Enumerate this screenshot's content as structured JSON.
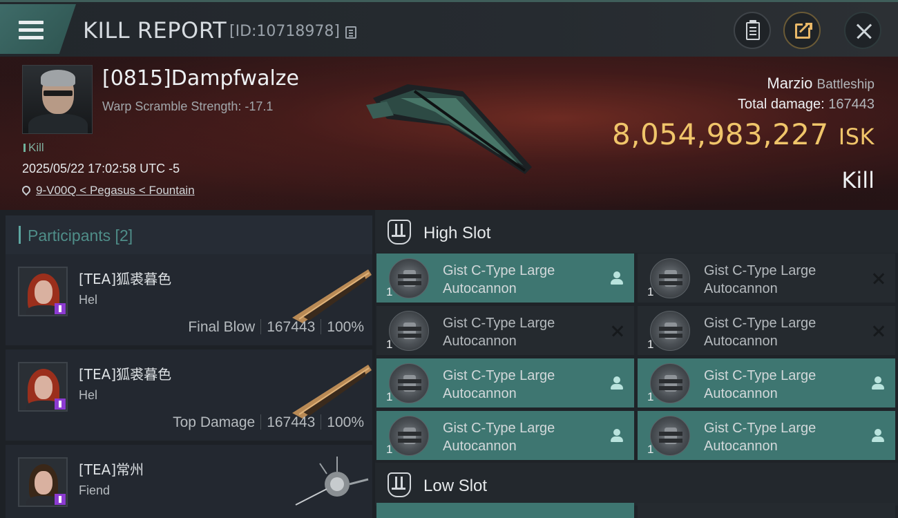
{
  "header": {
    "title": "KILL REPORT",
    "id_label": "[ID:10718978]"
  },
  "victim": {
    "name": "[0815]Dampfwalze",
    "scramble": "Warp Scramble Strength: -17.1",
    "tag": "Kill",
    "timestamp": "2025/05/22 17:02:58 UTC -5",
    "location": "9-V00Q < Pegasus < Fountain",
    "ship_name": "Marzio",
    "ship_class": "Battleship",
    "total_damage_label": "Total damage:",
    "total_damage_value": "167443",
    "isk_value": "8,054,983,227",
    "isk_unit": "ISK",
    "result": "Kill"
  },
  "participants": {
    "title": "Participants [2]",
    "items": [
      {
        "name": "[TEA]狐裘暮色",
        "ship": "Hel",
        "role": "Final Blow",
        "damage": "167443",
        "percent": "100%"
      },
      {
        "name": "[TEA]狐裘暮色",
        "ship": "Hel",
        "role": "Top Damage",
        "damage": "167443",
        "percent": "100%"
      },
      {
        "name": "[TEA]常州",
        "ship": "Fiend"
      }
    ]
  },
  "slots": {
    "high_slot_label": "High Slot",
    "low_slot_label": "Low Slot",
    "high_modules": [
      {
        "line1": "Gist C-Type Large",
        "line2": "Autocannon",
        "count": "1",
        "state": "active",
        "icon": "person-icon"
      },
      {
        "line1": "Gist C-Type Large",
        "line2": "Autocannon",
        "count": "1",
        "state": "inactive",
        "icon": "x-icon"
      },
      {
        "line1": "Gist C-Type Large",
        "line2": "Autocannon",
        "count": "1",
        "state": "inactive",
        "icon": "x-icon"
      },
      {
        "line1": "Gist C-Type Large",
        "line2": "Autocannon",
        "count": "1",
        "state": "inactive",
        "icon": "x-icon"
      },
      {
        "line1": "Gist C-Type Large",
        "line2": "Autocannon",
        "count": "1",
        "state": "active",
        "icon": "person-icon"
      },
      {
        "line1": "Gist C-Type Large",
        "line2": "Autocannon",
        "count": "1",
        "state": "active",
        "icon": "person-icon"
      },
      {
        "line1": "Gist C-Type Large",
        "line2": "Autocannon",
        "count": "1",
        "state": "active",
        "icon": "person-icon"
      },
      {
        "line1": "Gist C-Type Large",
        "line2": "Autocannon",
        "count": "1",
        "state": "active",
        "icon": "person-icon"
      }
    ]
  },
  "colors": {
    "accent_teal": "#3e7671",
    "isk_gold": "#f0c56a"
  }
}
